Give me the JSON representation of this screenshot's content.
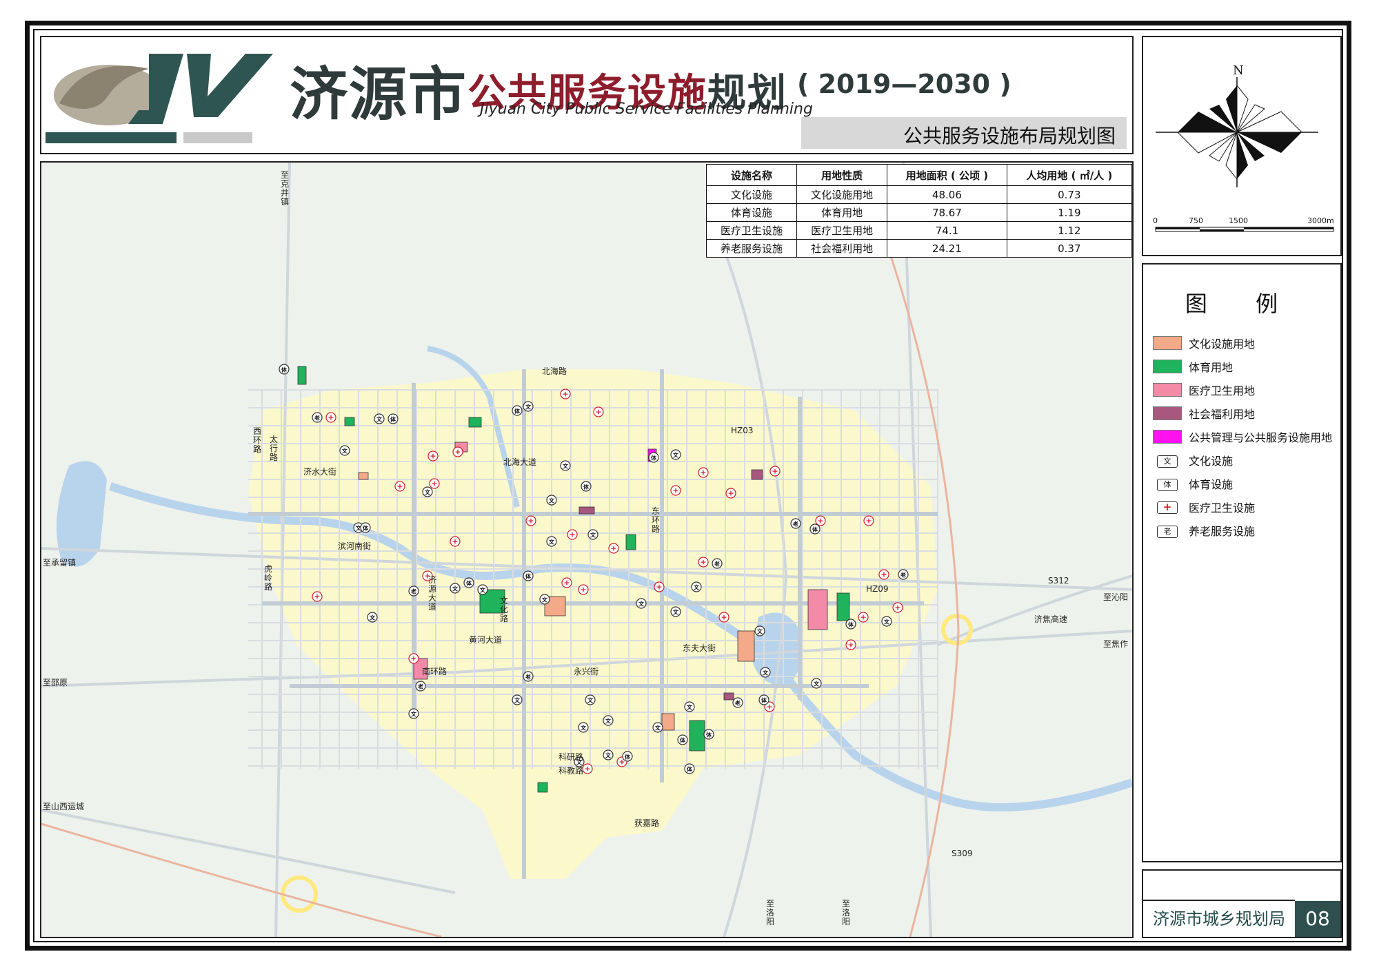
{
  "header": {
    "title_city": "济源市",
    "title_main": "公共服务设施",
    "title_suffix": "规划",
    "title_year": "( 2019—2030 )",
    "title_en": "Jiyuan City Public Service Facilities Planning",
    "subtitle": "公共服务设施布局规划图",
    "logo_text": "JY"
  },
  "stats_table": {
    "headers": [
      "设施名称",
      "用地性质",
      "用地面积 ( 公顷 )",
      "人均用地 ( ㎡/人 )"
    ],
    "rows": [
      [
        "文化设施",
        "文化设施用地",
        "48.06",
        "0.73"
      ],
      [
        "体育设施",
        "体育用地",
        "78.67",
        "1.19"
      ],
      [
        "医疗卫生设施",
        "医疗卫生用地",
        "74.1",
        "1.12"
      ],
      [
        "养老服务设施",
        "社会福利用地",
        "24.21",
        "0.37"
      ]
    ]
  },
  "compass": {
    "north_label": "N",
    "scale_labels": [
      "0",
      "750",
      "1500",
      "3000m"
    ]
  },
  "legend": {
    "title": "图 例",
    "area_items": [
      {
        "label": "文化设施用地",
        "color": "#f4a988"
      },
      {
        "label": "体育用地",
        "color": "#1fb35b"
      },
      {
        "label": "医疗卫生用地",
        "color": "#f28aa8"
      },
      {
        "label": "社会福利用地",
        "color": "#a8577f"
      },
      {
        "label": "公共管理与公共服务设施用地",
        "color": "#ff12f0"
      }
    ],
    "symbol_items": [
      {
        "label": "文化设施",
        "glyph": "文"
      },
      {
        "label": "体育设施",
        "glyph": "体"
      },
      {
        "label": "医疗卫生设施",
        "glyph": "+"
      },
      {
        "label": "养老服务设施",
        "glyph": "老"
      }
    ]
  },
  "map_labels": {
    "to_kejing": "至克井镇",
    "to_chengliu": "至承留镇",
    "to_qinyang": "至沁阳",
    "to_jiaozuo": "至焦作",
    "to_shaoyuan": "至邵原",
    "to_shanxi": "至山西运城",
    "to_luoyang_1": "至洛阳",
    "to_luoyang_2": "至洛阳",
    "jijiao_highway": "济焦高速",
    "s312": "S312",
    "s309": "S309",
    "hz03": "HZ03",
    "hz09": "HZ09",
    "jishui_street": "济水大街",
    "binhe_street": "滨河南街",
    "beihai_road": "北海路",
    "beihai_avenue": "北海大道",
    "huanghe_avenue": "黄河大道",
    "yongxing_street": "永兴街",
    "nanhuan_road": "南环路",
    "keyan_road": "科研路",
    "kejiao_road": "科教路",
    "huojin_road": "获嘉路",
    "dongfu_street": "东夫大街",
    "donghuan_road": "东环路",
    "xihuan_road": "西环路",
    "wenhua_road": "文化路",
    "taihang_road": "太行路",
    "jingji_avenue": "济源大道",
    "huling_road": "虎岭路"
  },
  "footer": {
    "org": "济源市城乡规划局",
    "page_number": "08"
  },
  "colors": {
    "culture": "#f4a988",
    "sport": "#1fb35b",
    "medical": "#f28aa8",
    "welfare": "#a8577f",
    "public_admin": "#ff12f0",
    "urban_fill": "#fbf8cc",
    "road": "#cfd6dc",
    "water": "#b8d3ec",
    "green": "#e3f0e0"
  }
}
